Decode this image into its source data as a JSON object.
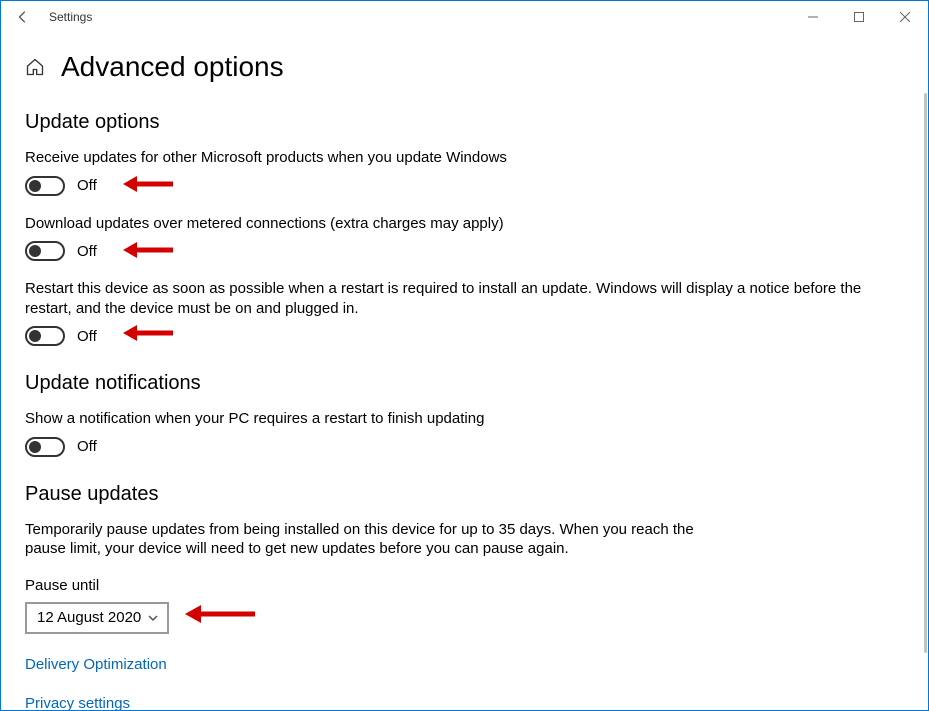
{
  "window": {
    "title": "Settings"
  },
  "header": {
    "page_title": "Advanced options"
  },
  "sections": {
    "update_options": {
      "title": "Update options",
      "opt1": {
        "desc": "Receive updates for other Microsoft products when you update Windows",
        "state": "Off"
      },
      "opt2": {
        "desc": "Download updates over metered connections (extra charges may apply)",
        "state": "Off"
      },
      "opt3": {
        "desc": "Restart this device as soon as possible when a restart is required to install an update. Windows will display a notice before the restart, and the device must be on and plugged in.",
        "state": "Off"
      }
    },
    "update_notifications": {
      "title": "Update notifications",
      "opt1": {
        "desc": "Show a notification when your PC requires a restart to finish updating",
        "state": "Off"
      }
    },
    "pause_updates": {
      "title": "Pause updates",
      "desc": "Temporarily pause updates from being installed on this device for up to 35 days. When you reach the pause limit, your device will need to get new updates before you can pause again.",
      "label": "Pause until",
      "selected": "12 August 2020"
    }
  },
  "links": {
    "delivery_optimization": "Delivery Optimization",
    "privacy_settings": "Privacy settings"
  }
}
